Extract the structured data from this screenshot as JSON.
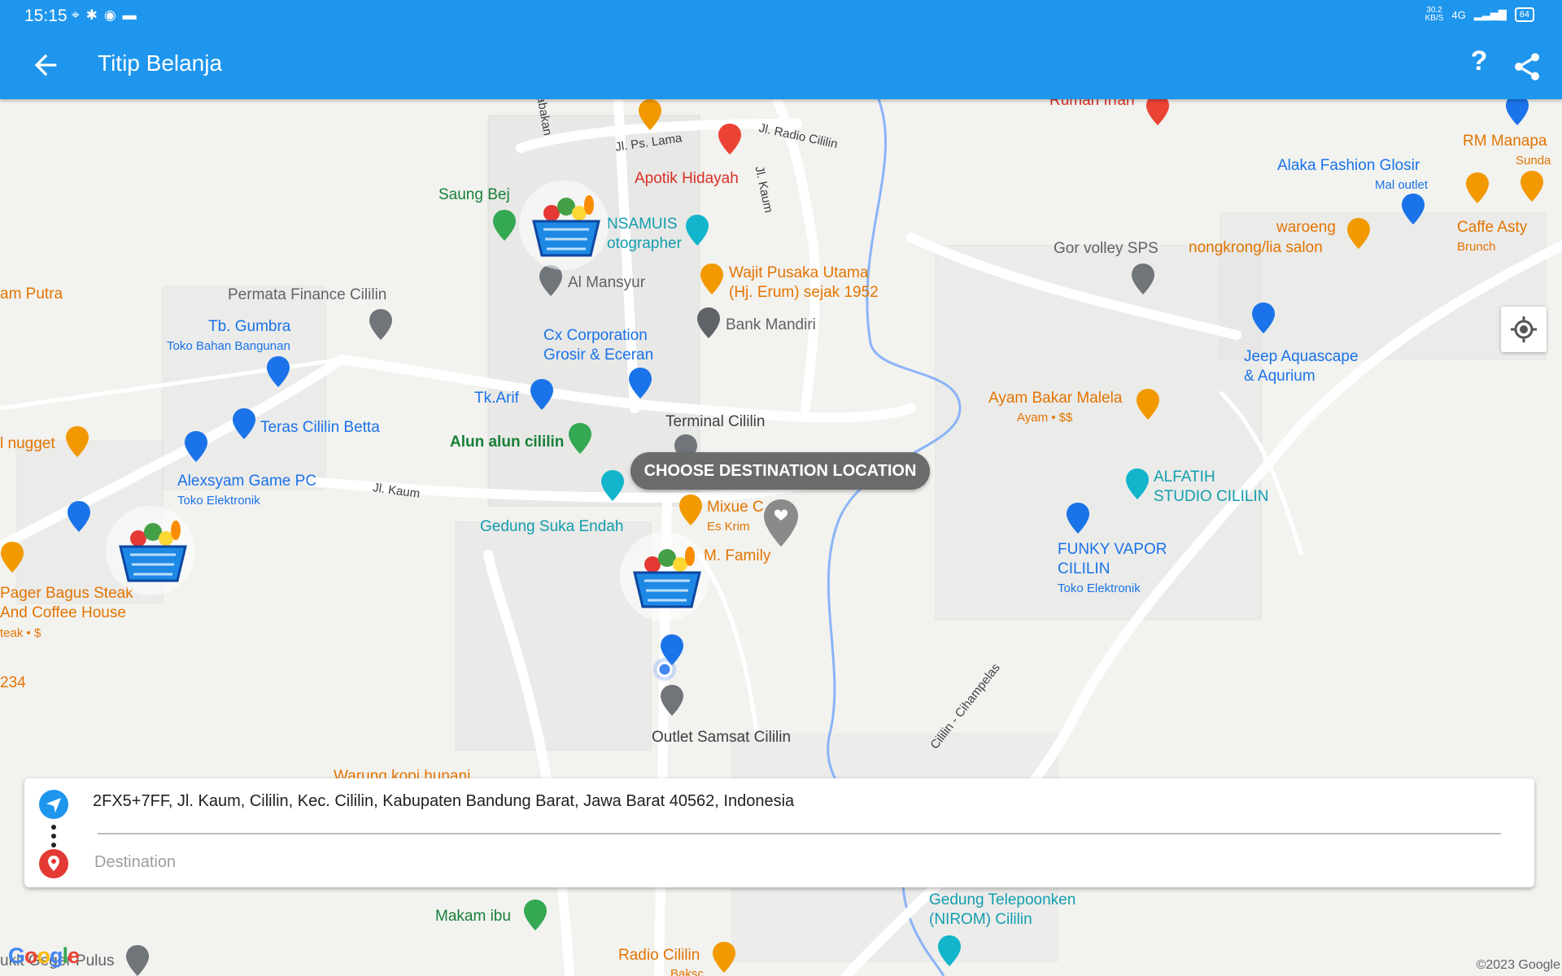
{
  "status_bar": {
    "time": "15:15",
    "icons": [
      "location-icon",
      "bluetooth-icon",
      "spotify-icon",
      "battery-saver-icon"
    ],
    "net_speed": "30.2",
    "net_unit": "KB/S",
    "network": "4G",
    "battery": "64"
  },
  "app_bar": {
    "title": "Titip Belanja",
    "help_label": "?",
    "accent_color": "#1e96ee"
  },
  "map": {
    "overlay_label": "CHOOSE DESTINATION LOCATION",
    "labels": {
      "rumah_irfan": "Rumah Irfan",
      "rm_manapa": "RM Manapa",
      "sunda": "Sunda",
      "alaka": "Alaka Fashion Glosir",
      "mal_outlet": "Mal outlet",
      "caffe_asty": "Caffe Asty",
      "brunch": "Brunch",
      "waroeng": "waroeng",
      "nongkrong": "nongkrong/lia salon",
      "gor_volley": "Gor volley SPS",
      "jl_ps_lama": "Jl. Ps. Lama",
      "jl_radio": "Jl. Radio Cililin",
      "jl_kaum_v": "Jl. Kaum",
      "abakan": "abakan",
      "apotik": "Apotik Hidayah",
      "saung": "Saung Bej",
      "nsamuis": "NSAMUIS",
      "otographer": "otographer",
      "al_mansyur": "Al Mansyur",
      "wajit_1": "Wajit Pusaka Utama",
      "wajit_2": "(Hj. Erum) sejak 1952",
      "bank_mandiri": "Bank Mandiri",
      "cx_1": "Cx Corporation",
      "cx_2": "Grosir & Eceran",
      "permata": "Permata Finance Cililin",
      "tb_gumbra": "Tb. Gumbra",
      "toko_bahan": "Toko Bahan Bangunan",
      "am_putra": "am Putra",
      "tk_arif": "Tk.Arif",
      "teras": "Teras Cililin Betta",
      "terminal": "Terminal Cililin",
      "alun": "Alun alun cililin",
      "nugget": "l nugget",
      "alexsyam": "Alexsyam Game PC",
      "toko_elektronik": "Toko Elektronik",
      "jl_kaum": "Jl. Kaum",
      "gedung_suka": "Gedung Suka Endah",
      "mixue": "Mixue C",
      "es_krim": "Es Krim",
      "m_family": "M. Family",
      "pager_1": "Pager Bagus Steak",
      "pager_2": "And Coffee House",
      "steak": "teak • $",
      "num_234": "234",
      "ayam_bakar": "Ayam Bakar Malela",
      "ayam_sub": "Ayam • $$",
      "jeep_1": "Jeep Aquascape",
      "jeep_2": "& Aqurium",
      "alfatih_1": "ALFATIH",
      "alfatih_2": "STUDIO CILILIN",
      "funky_1": "FUNKY VAPOR",
      "funky_2": "CILILIN",
      "funky_sub": "Toko Elektronik",
      "road_cihampelas": "Cililin - Cihampelas",
      "outlet": "Outlet Samsat Cililin",
      "warung": "Warung kopi hunani",
      "makam": "Makam ibu",
      "gedung_tel_1": "Gedung Telepoonken",
      "gedung_tel_2": "(NIROM) Cililin",
      "radio_cililin": "Radio Cililin",
      "baksc": "Baksc",
      "bukit": "ukit Geger Pulus"
    },
    "google_logo": "Google",
    "copyright": "©2023 Google"
  },
  "route_card": {
    "origin": "2FX5+7FF, Jl. Kaum, Cililin, Kec. Cililin, Kabupaten Bandung Barat, Jawa Barat 40562, Indonesia",
    "destination_value": "",
    "destination_placeholder": "Destination"
  }
}
